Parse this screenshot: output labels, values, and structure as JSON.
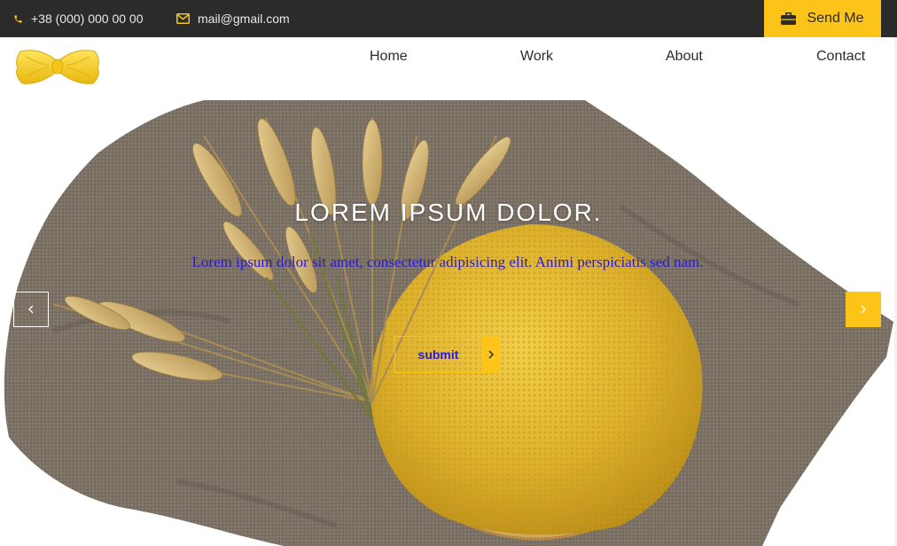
{
  "topbar": {
    "phone": "+38 (000) 000 00 00",
    "email": "mail@gmail.com",
    "send_label": "Send Me",
    "icons": {
      "phone": "phone-icon",
      "email": "envelope-icon",
      "send": "briefcase-icon"
    }
  },
  "nav": {
    "items": [
      {
        "label": "Home"
      },
      {
        "label": "Work"
      },
      {
        "label": "About"
      },
      {
        "label": "Contact"
      }
    ]
  },
  "hero": {
    "title": "LOREM IPSUM DOLOR.",
    "subtitle": "Lorem ipsum dolor sit amet, consectetur adipisicing elit. Animi perspiciatis sed nam.",
    "submit_label": "submit",
    "prev_symbol": "‹",
    "next_symbol": "›"
  },
  "colors": {
    "accent": "#fcc419",
    "topbar": "#2b2b2b",
    "subtitle_text": "#2a1ad8"
  }
}
